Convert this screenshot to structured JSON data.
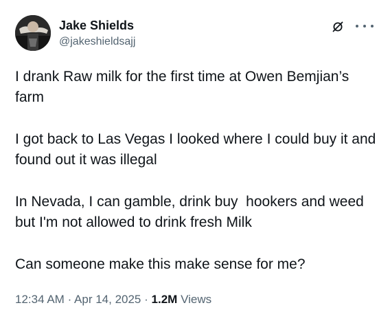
{
  "author": {
    "display_name": "Jake Shields",
    "handle": "@jakeshieldsajj"
  },
  "header_icons": [
    "grok-icon",
    "more-icon"
  ],
  "tweet": {
    "paragraphs": [
      "I drank Raw milk for the first time at Owen Bemjian’s farm",
      "I got back to Las Vegas I looked where I could buy it and found out it was illegal",
      "In Nevada, I can gamble, drink buy  hookers and weed but I'm not allowed to drink fresh Milk",
      "Can someone make this make sense for me?"
    ]
  },
  "meta": {
    "time": "12:34 AM",
    "separator": "·",
    "date": "Apr 14, 2025",
    "views_count": "1.2M",
    "views_label": "Views"
  }
}
